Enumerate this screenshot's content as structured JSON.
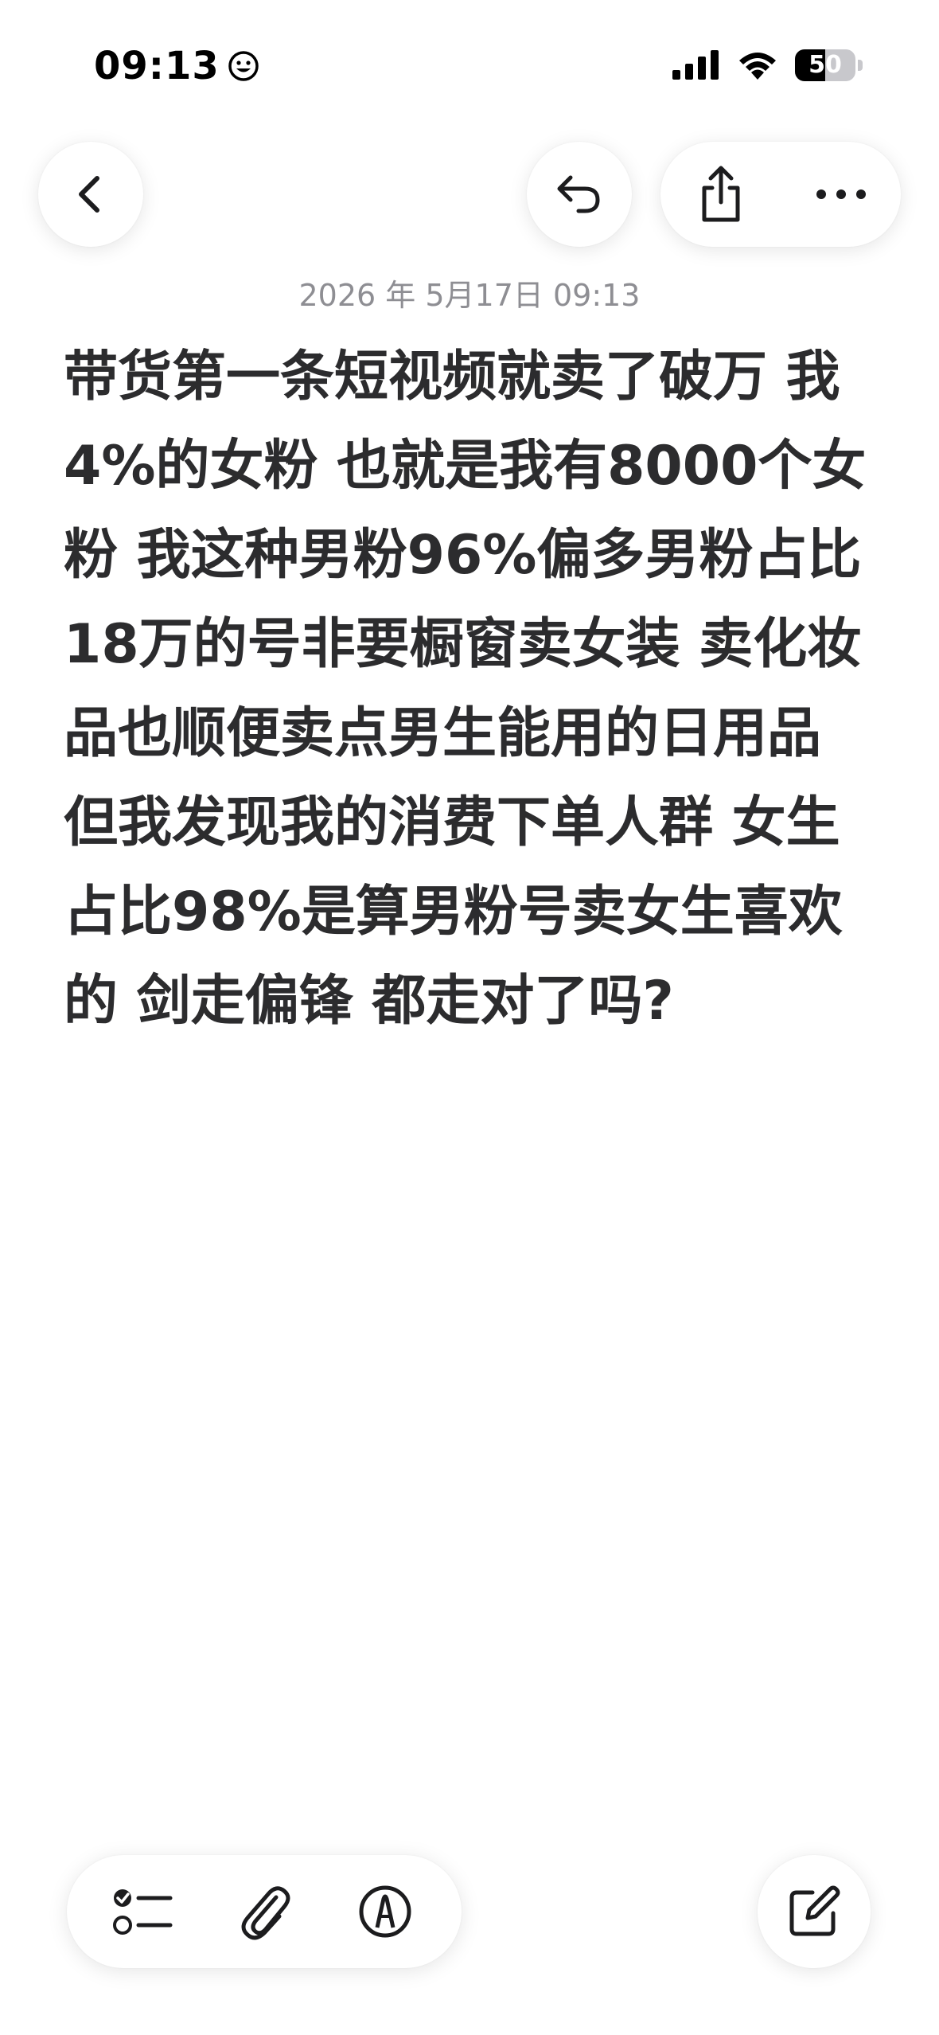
{
  "status_bar": {
    "time": "09:13",
    "battery_level": "50",
    "battery_fraction": 0.5
  },
  "toolbar": {
    "back_icon": "chevron-left-icon",
    "undo_icon": "undo-icon",
    "share_icon": "share-icon",
    "more_icon": "ellipsis-icon"
  },
  "note": {
    "date": "2026 年 5月17日 09:13",
    "body": "带货第一条短视频就卖了破万 我4%的女粉 也就是我有8000个女粉 我这种男粉96%偏多男粉占比18万的号非要橱窗卖女装 卖化妆品也顺便卖点男生能用的日用品 但我发现我的消费下单人群 女生占比98%是算男粉号卖女生喜欢的 剑走偏锋 都走对了吗?"
  },
  "bottom_toolbar": {
    "checklist_icon": "checklist-icon",
    "attach_icon": "paperclip-icon",
    "markup_icon": "markup-pen-icon",
    "compose_icon": "compose-icon"
  },
  "colors": {
    "text": "#2c2c2e",
    "date": "#8e8e93",
    "background": "#ffffff"
  }
}
